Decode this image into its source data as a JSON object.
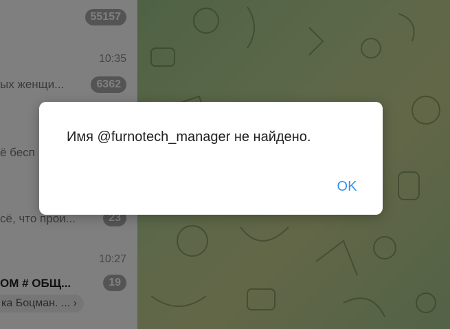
{
  "chat_list": {
    "items": [
      {
        "time": "",
        "snippet": "",
        "badge": "55157"
      },
      {
        "time": "10:35",
        "snippet": "ых женщи...",
        "badge": "6362"
      },
      {
        "time": "",
        "snippet": "ё бесп",
        "badge": ""
      },
      {
        "time": "",
        "snippet": "сё, что прои...",
        "badge": "23"
      },
      {
        "time": "10:27",
        "snippet": "ОМ # ОБЩ...",
        "badge": "19",
        "preview": "ка Боцман. ..."
      }
    ]
  },
  "dialog": {
    "message": "Имя @furnotech_manager не найдено.",
    "ok_label": "OK"
  },
  "colors": {
    "accent": "#3390ec",
    "overlay": "rgba(0,0,0,0.5)",
    "chat_bg": "#b5cf93"
  }
}
